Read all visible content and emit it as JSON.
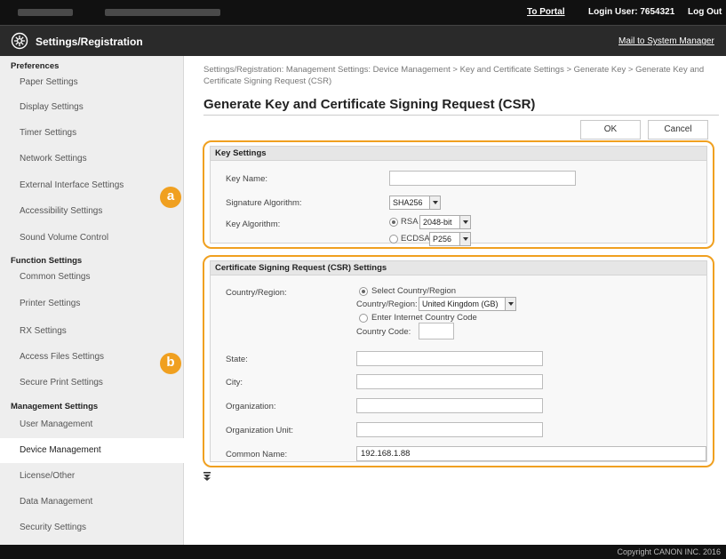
{
  "topbar": {
    "portal": "To Portal",
    "login_user": "Login User:  7654321",
    "logout": "Log Out"
  },
  "titlebar": {
    "title": "Settings/Registration",
    "mail": "Mail to System Manager"
  },
  "sidebar": {
    "preferences": "Preferences",
    "pref_items": [
      "Paper Settings",
      "Display Settings",
      "Timer Settings",
      "Network Settings",
      "External Interface Settings",
      "Accessibility Settings",
      "Sound Volume Control"
    ],
    "function_settings": "Function Settings",
    "func_items": [
      "Common Settings",
      "Printer Settings",
      "RX Settings",
      "Access Files Settings",
      "Secure Print Settings"
    ],
    "management_settings": "Management Settings",
    "mgmt_items": [
      "User Management",
      "Device Management",
      "License/Other",
      "Data Management",
      "Security Settings"
    ]
  },
  "breadcrumb": "Settings/Registration: Management Settings: Device Management > Key and Certificate Settings > Generate Key > Generate Key and Certificate Signing Request (CSR)",
  "page_title": "Generate Key and Certificate Signing Request (CSR)",
  "buttons": {
    "ok": "OK",
    "cancel": "Cancel"
  },
  "key_settings": {
    "heading": "Key Settings",
    "key_name_label": "Key Name:",
    "key_name_value": "",
    "sig_alg_label": "Signature Algorithm:",
    "sig_alg_value": "SHA256",
    "key_alg_label": "Key Algorithm:",
    "rsa_label": "RSA",
    "rsa_value": "2048-bit",
    "ecdsa_label": "ECDSA",
    "ecdsa_value": "P256"
  },
  "csr_settings": {
    "heading": "Certificate Signing Request (CSR) Settings",
    "country_label": "Country/Region:",
    "select_country": "Select Country/Region",
    "country_region_label": "Country/Region:",
    "country_value": "United Kingdom (GB)",
    "enter_code": "Enter Internet Country Code",
    "country_code_label": "Country Code:",
    "country_code_value": "",
    "state_label": "State:",
    "city_label": "City:",
    "org_label": "Organization:",
    "org_unit_label": "Organization Unit:",
    "common_name_label": "Common Name:",
    "common_name_value": "192.168.1.88"
  },
  "badges": {
    "a": "a",
    "b": "b"
  },
  "footer": {
    "copyright": "Copyright CANON INC. 2016"
  },
  "colors": {
    "accent": "#f0a020",
    "topbar": "#111111",
    "titlebar": "#2a2a2a"
  },
  "icons": {
    "title": "settings-gear-icon",
    "back_to_top": "back-to-top-icon"
  }
}
